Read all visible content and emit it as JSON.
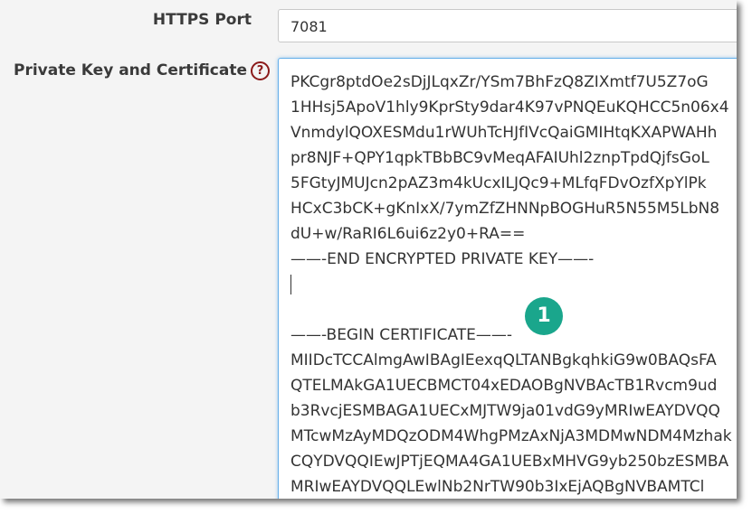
{
  "https_port": {
    "label": "HTTPS Port",
    "value": "7081"
  },
  "private_key": {
    "label": "Private Key and Certificate",
    "help_icon": "?",
    "lines": [
      "",
      "PKCgr8ptdOe2sDjJLqxZr/YSm7BhFzQ8ZIXmtf7U5Z7oG",
      "1HHsj5ApoV1hly9KprSty9dar4K97vPNQEuKQHCC5n06x4",
      "VnmdylQOXESMdu1rWUhTcHJfIVcQaiGMIHtqKXAPWAHh",
      "pr8NJF+QPY1qpkTBbBC9vMeqAFAIUhl2znpTpdQjfsGoL",
      "5FGtyJMUJcn2pAZ3m4kUcxILJQc9+MLfqFDvOzfXpYlPk",
      "HCxC3bCK+gKnIxX/7ymZfZHNNpBOGHuR5N55M5LbN8",
      "dU+w/RaRI6L6ui6z2y0+RA==",
      "——-END ENCRYPTED PRIVATE KEY——-",
      "",
      "",
      "——-BEGIN CERTIFICATE——-",
      "MIIDcTCCAlmgAwIBAgIEexqQLTANBgkqhkiG9w0BAQsFA",
      "QTELMAkGA1UECBMCT04xEDAOBgNVBAcTB1Rvcm9ud",
      "b3RvcjESMBAGA1UECxMJTW9ja01vdG9yMRIwEAYDVQQ",
      "MTcwMzAyMDQzODM4WhgPMzAxNjA3MDMwNDM4Mzhak",
      "CQYDVQQIEwJPTjEQMA4GA1UEBxMHVG9yb250bzESMBA",
      "MRIwEAYDVQQLEwlNb2NrTW90b3IxEjAQBgNVBAMTCl"
    ]
  },
  "callout": {
    "number": "1",
    "color": "#1aa68c"
  },
  "colors": {
    "help_icon": "#8b1a1a",
    "focus_border": "#66afe9"
  }
}
